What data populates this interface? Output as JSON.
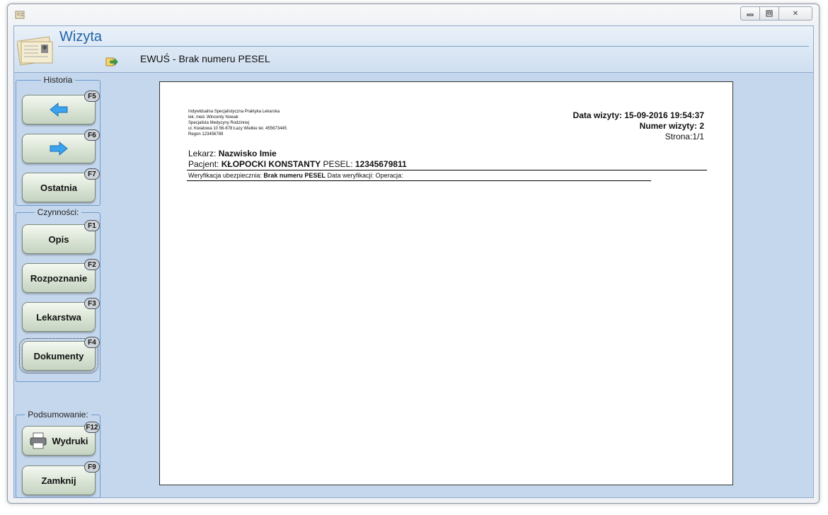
{
  "window": {
    "app_icon": "app-window-icon",
    "controls": {
      "minimize_icon": "minimize-icon",
      "maximize_icon": "maximize-icon",
      "close_icon": "close-icon",
      "close_glyph": "✕"
    }
  },
  "header": {
    "title": "Wizyta",
    "logo_icon": "patient-card-icon",
    "subtitle_icon": "export-arrow-icon",
    "subtitle": "EWUŚ - Brak numeru PESEL"
  },
  "sidebar": {
    "historia": {
      "label": "Historia",
      "buttons": [
        {
          "id": "back",
          "label": "",
          "icon": "arrow-left-icon",
          "fkey": "F5"
        },
        {
          "id": "forward",
          "label": "",
          "icon": "arrow-right-icon",
          "fkey": "F6"
        },
        {
          "id": "last",
          "label": "Ostatnia",
          "fkey": "F7"
        }
      ]
    },
    "czynnosci": {
      "label": "Czynności:",
      "buttons": [
        {
          "id": "opis",
          "label": "Opis",
          "fkey": "F1"
        },
        {
          "id": "rozpoznanie",
          "label": "Rozpoznanie",
          "fkey": "F2"
        },
        {
          "id": "lekarstwa",
          "label": "Lekarstwa",
          "fkey": "F3"
        },
        {
          "id": "dokumenty",
          "label": "Dokumenty",
          "fkey": "F4"
        }
      ]
    },
    "podsumowanie": {
      "label": "Podsumowanie:",
      "buttons": [
        {
          "id": "wydruki",
          "label": "Wydruki",
          "icon": "printer-icon",
          "fkey": "F12"
        },
        {
          "id": "zamknij",
          "label": "Zamknij",
          "fkey": "F9"
        }
      ]
    }
  },
  "document": {
    "clinic_lines": [
      "Indywidualna Specjalistyczna Praktyka Lekarska",
      "lek. med. Wincenty Nowak",
      "Specjalista Medycyny Rodzinnej",
      "ul. Kwiatowa 10 56-678 Łazy Wielkie tel. 455673445",
      "Regon 123456789"
    ],
    "visit_date_label": "Data wizyty:",
    "visit_date": "15-09-2016 19:54:37",
    "visit_number_label": "Numer wizyty:",
    "visit_number": "2",
    "page": "Strona:1/1",
    "doctor_label": "Lekarz:",
    "doctor_name": "Nazwisko Imie",
    "patient_label": "Pacjent:",
    "patient_name": "KŁOPOCKI KONSTANTY",
    "pesel_label": "PESEL:",
    "pesel": "12345679811",
    "verification_label": "Weryfikacja ubezpiecznia:",
    "verification_value": "Brak numeru PESEL",
    "verification_date_label": "Data weryfikacji:",
    "operation_label": "Operacja:"
  }
}
